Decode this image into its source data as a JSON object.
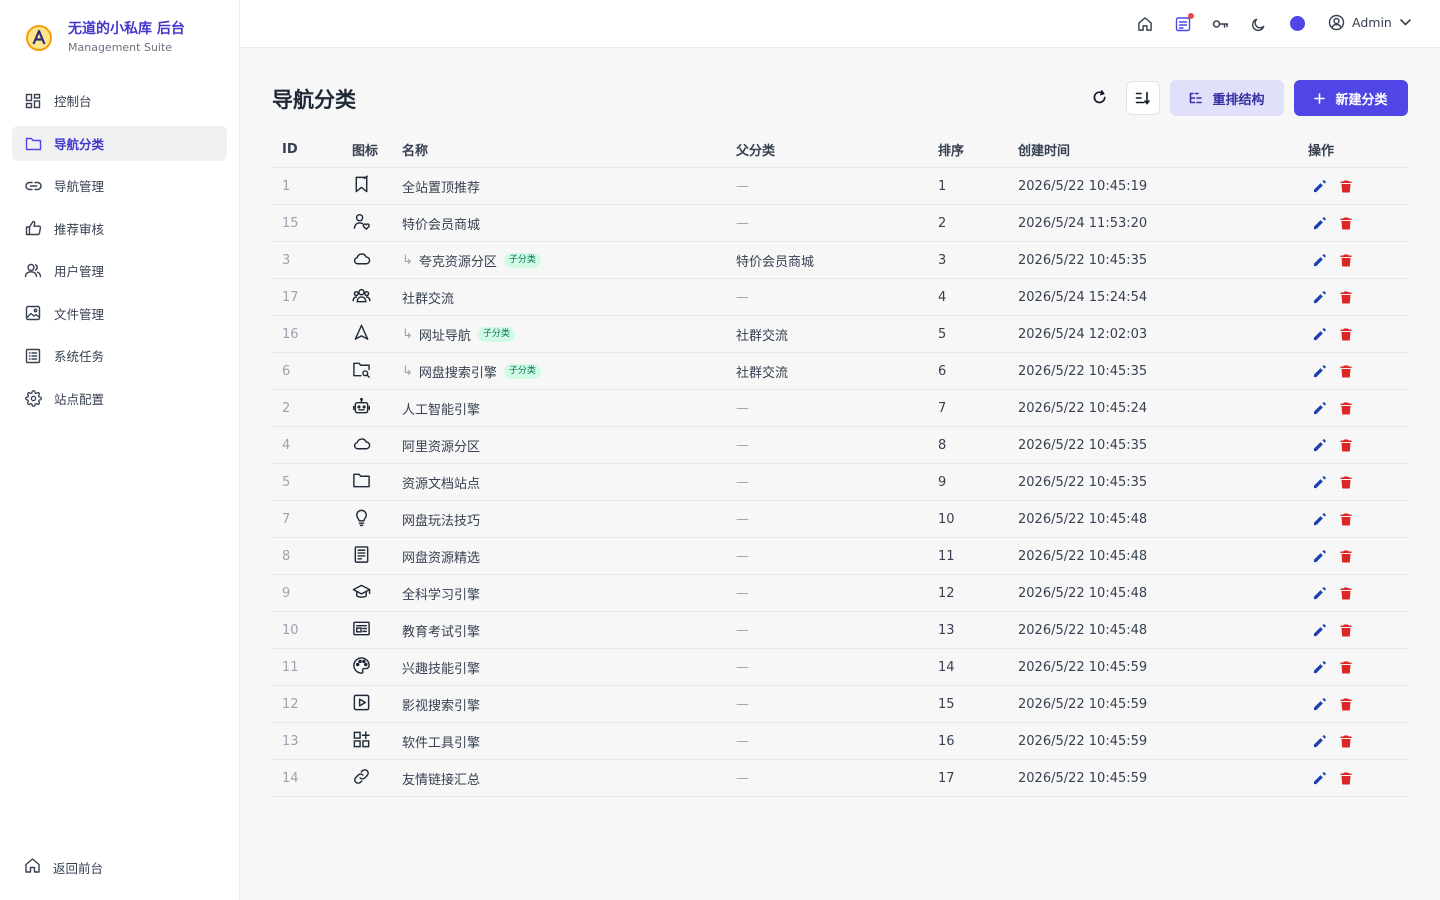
{
  "brand": {
    "title": "无道的小私库 后台",
    "subtitle": "Management Suite"
  },
  "sidebar": {
    "items": [
      {
        "label": "控制台",
        "icon": "dashboard-icon"
      },
      {
        "label": "导航分类",
        "icon": "folder-icon",
        "active": true
      },
      {
        "label": "导航管理",
        "icon": "link-icon"
      },
      {
        "label": "推荐审核",
        "icon": "thumbs-up-icon"
      },
      {
        "label": "用户管理",
        "icon": "users-icon"
      },
      {
        "label": "文件管理",
        "icon": "image-icon"
      },
      {
        "label": "系统任务",
        "icon": "list-icon"
      },
      {
        "label": "站点配置",
        "icon": "gear-icon"
      }
    ],
    "back_label": "返回前台"
  },
  "header": {
    "user_name": "Admin",
    "accent": "#4f46e5"
  },
  "page": {
    "title": "导航分类",
    "restructure_label": "重排结构",
    "new_label": "新建分类"
  },
  "table": {
    "columns": {
      "id": "ID",
      "icon": "图标",
      "name": "名称",
      "parent": "父分类",
      "sort": "排序",
      "created": "创建时间",
      "ops": "操作"
    },
    "sub_badge": "子分类",
    "rows": [
      {
        "id": "1",
        "icon": "bookmark-icon",
        "name": "全站置顶推荐",
        "parent": "—",
        "sort": "1",
        "created": "2026/5/22 10:45:19",
        "child": false
      },
      {
        "id": "15",
        "icon": "user-heart-icon",
        "name": "特价会员商城",
        "parent": "—",
        "sort": "2",
        "created": "2026/5/24 11:53:20",
        "child": false
      },
      {
        "id": "3",
        "icon": "cloud-icon",
        "name": "夸克资源分区",
        "parent": "特价会员商城",
        "sort": "3",
        "created": "2026/5/22 10:45:35",
        "child": true
      },
      {
        "id": "17",
        "icon": "group-icon",
        "name": "社群交流",
        "parent": "—",
        "sort": "4",
        "created": "2026/5/24 15:24:54",
        "child": false
      },
      {
        "id": "16",
        "icon": "navigation-icon",
        "name": "网址导航",
        "parent": "社群交流",
        "sort": "5",
        "created": "2026/5/24 12:02:03",
        "child": true
      },
      {
        "id": "6",
        "icon": "folder-search-icon",
        "name": "网盘搜索引擎",
        "parent": "社群交流",
        "sort": "6",
        "created": "2026/5/22 10:45:35",
        "child": true
      },
      {
        "id": "2",
        "icon": "robot-icon",
        "name": "人工智能引擎",
        "parent": "—",
        "sort": "7",
        "created": "2026/5/22 10:45:24",
        "child": false
      },
      {
        "id": "4",
        "icon": "cloud-icon",
        "name": "阿里资源分区",
        "parent": "—",
        "sort": "8",
        "created": "2026/5/22 10:45:35",
        "child": false
      },
      {
        "id": "5",
        "icon": "folder-icon",
        "name": "资源文档站点",
        "parent": "—",
        "sort": "9",
        "created": "2026/5/22 10:45:35",
        "child": false
      },
      {
        "id": "7",
        "icon": "lightbulb-icon",
        "name": "网盘玩法技巧",
        "parent": "—",
        "sort": "10",
        "created": "2026/5/22 10:45:48",
        "child": false
      },
      {
        "id": "8",
        "icon": "document-icon",
        "name": "网盘资源精选",
        "parent": "—",
        "sort": "11",
        "created": "2026/5/22 10:45:48",
        "child": false
      },
      {
        "id": "9",
        "icon": "graduation-cap-icon",
        "name": "全科学习引擎",
        "parent": "—",
        "sort": "12",
        "created": "2026/5/22 10:45:48",
        "child": false
      },
      {
        "id": "10",
        "icon": "newspaper-icon",
        "name": "教育考试引擎",
        "parent": "—",
        "sort": "13",
        "created": "2026/5/22 10:45:48",
        "child": false
      },
      {
        "id": "11",
        "icon": "palette-icon",
        "name": "兴趣技能引擎",
        "parent": "—",
        "sort": "14",
        "created": "2026/5/22 10:45:59",
        "child": false
      },
      {
        "id": "12",
        "icon": "play-icon",
        "name": "影视搜索引擎",
        "parent": "—",
        "sort": "15",
        "created": "2026/5/22 10:45:59",
        "child": false
      },
      {
        "id": "13",
        "icon": "apps-add-icon",
        "name": "软件工具引擎",
        "parent": "—",
        "sort": "16",
        "created": "2026/5/22 10:45:59",
        "child": false
      },
      {
        "id": "14",
        "icon": "chain-link-icon",
        "name": "友情链接汇总",
        "parent": "—",
        "sort": "17",
        "created": "2026/5/22 10:45:59",
        "child": false
      }
    ]
  }
}
